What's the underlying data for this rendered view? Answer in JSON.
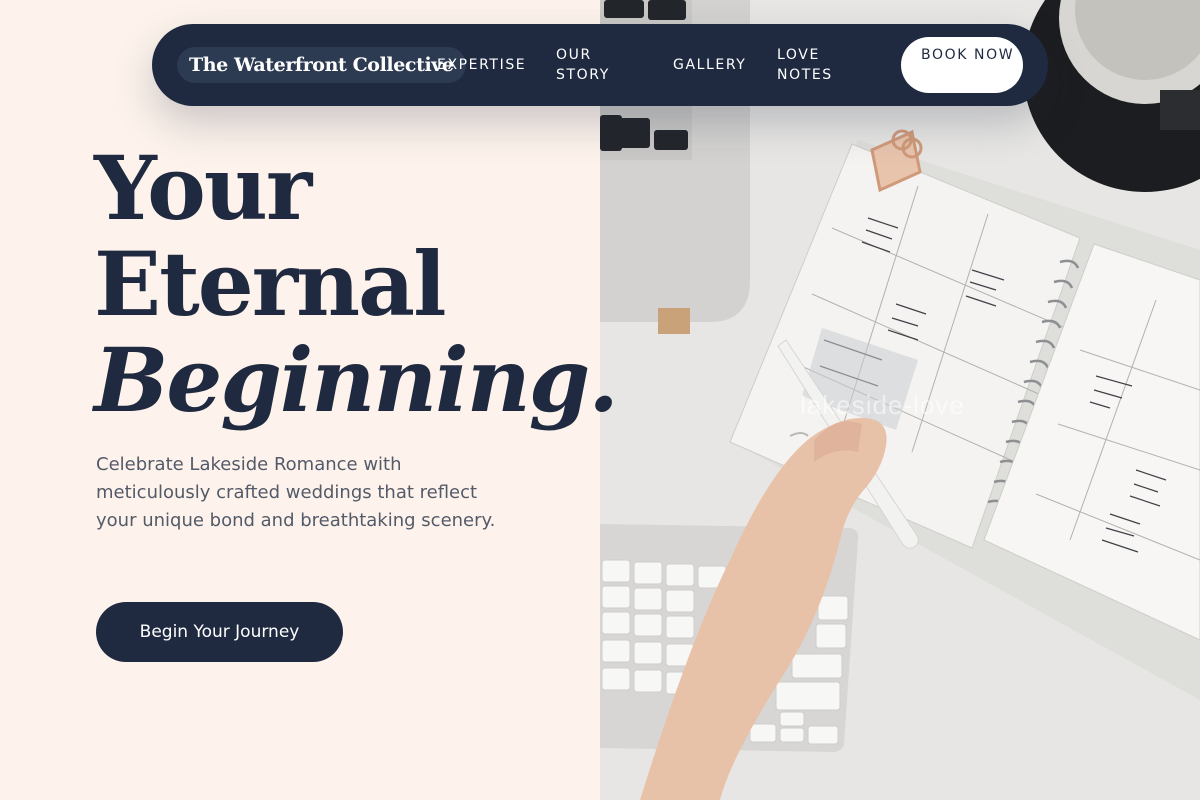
{
  "nav": {
    "brand": "The Waterfront Collective",
    "items": [
      {
        "label": "EXPERTISE"
      },
      {
        "label": "OUR STORY"
      },
      {
        "label": "GALLERY"
      },
      {
        "label": "LOVE NOTES"
      }
    ],
    "cta": "BOOK NOW"
  },
  "hero": {
    "headline_line1": "Your",
    "headline_line2": "Eternal",
    "headline_line3": "Beginning.",
    "intro": "Celebrate Lakeside Romance with meticulously crafted weddings that reflect your unique bond and breathtaking scenery.",
    "button": "Begin Your Journey"
  },
  "photo": {
    "watermark": "lakeside-love"
  },
  "colors": {
    "navy": "#1f2a40",
    "cream": "#fdf3ec",
    "text_muted": "#535a68"
  }
}
